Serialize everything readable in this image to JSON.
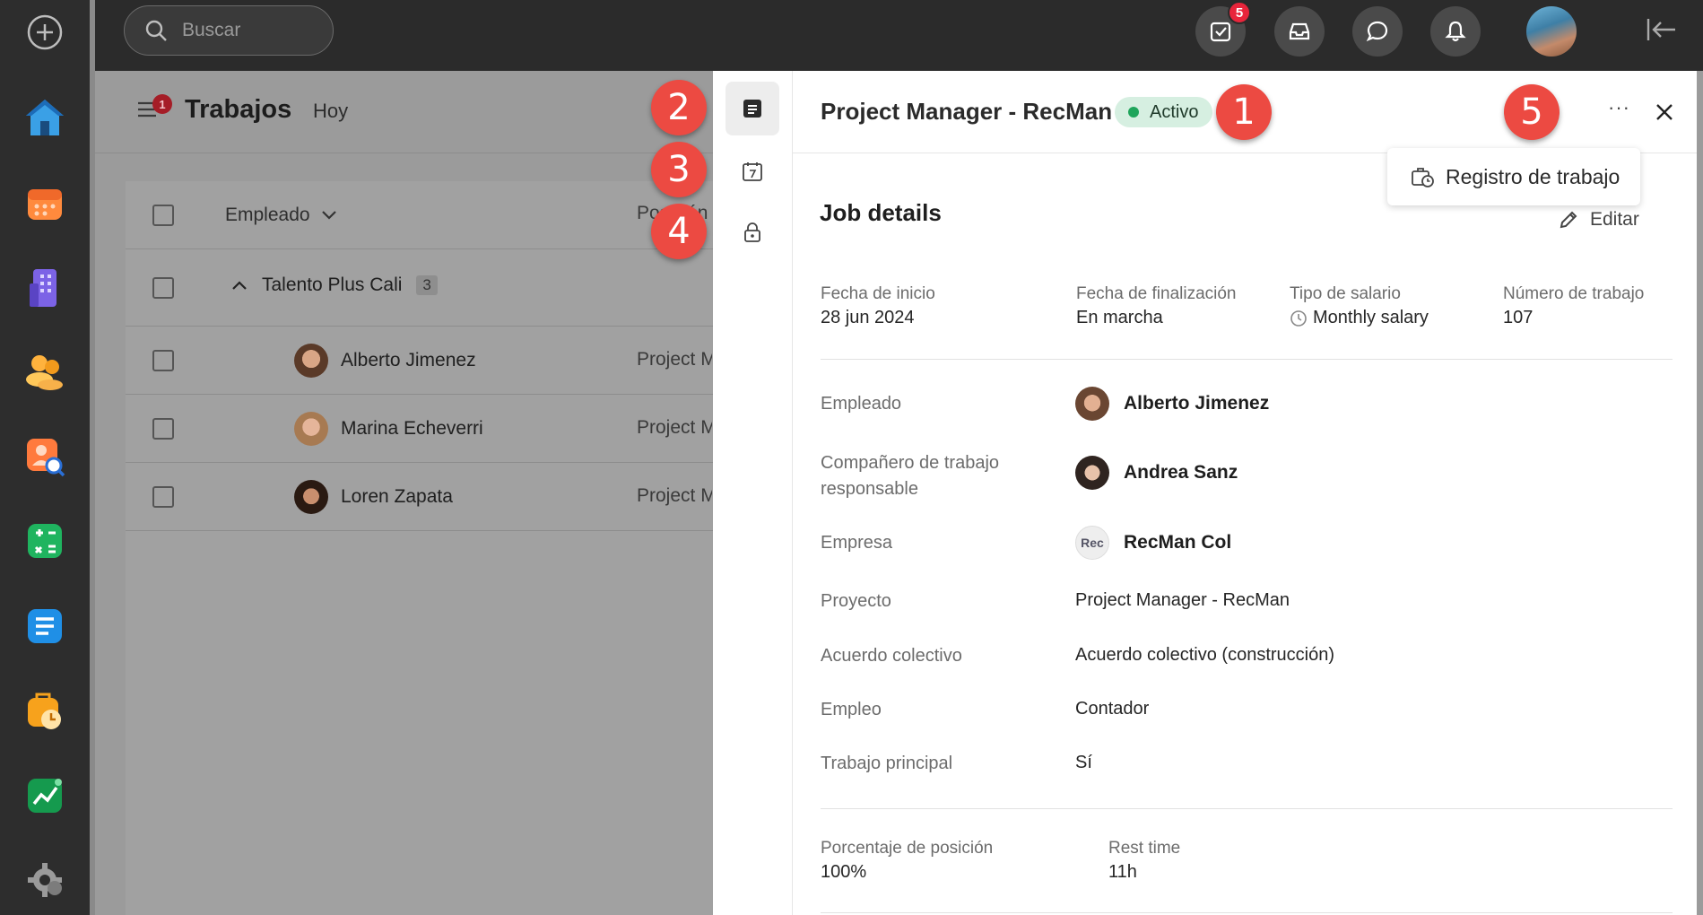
{
  "search": {
    "placeholder": "Buscar"
  },
  "topbar": {
    "tasks_badge": "5"
  },
  "page": {
    "title": "Trabajos",
    "subtitle": "Hoy",
    "menu_badge": "1"
  },
  "table": {
    "header_employee": "Empleado",
    "header_position": "Posición",
    "group": {
      "name": "Talento Plus Cali",
      "count": "3"
    },
    "rows": [
      {
        "name": "Alberto Jimenez",
        "position": "Project Manager - RecMan"
      },
      {
        "name": "Marina Echeverri",
        "position": "Project Manager - RecMan"
      },
      {
        "name": "Loren Zapata",
        "position": "Project Manager - RecMan"
      }
    ]
  },
  "markers": [
    "1",
    "2",
    "3",
    "4",
    "5"
  ],
  "drawer": {
    "title": "Project Manager - RecMan",
    "status": "Activo",
    "menu_item": "Registro de trabajo",
    "section_title": "Job details",
    "edit_label": "Editar",
    "summary": [
      {
        "label": "Fecha de inicio",
        "value": "28 jun 2024"
      },
      {
        "label": "Fecha de finalización",
        "value": "En marcha"
      },
      {
        "label": "Tipo de salario",
        "value": "Monthly salary"
      },
      {
        "label": "Número de trabajo",
        "value": "107"
      }
    ],
    "fields": {
      "employee": {
        "label": "Empleado",
        "value": "Alberto Jimenez"
      },
      "responsible": {
        "label": "Compañero de trabajo responsable",
        "value": "Andrea Sanz"
      },
      "company": {
        "label": "Empresa",
        "value": "RecMan Col",
        "logo_text": "Rec"
      },
      "project": {
        "label": "Proyecto",
        "value": "Project Manager - RecMan"
      },
      "agreement": {
        "label": "Acuerdo colectivo",
        "value": "Acuerdo colectivo (construcción)"
      },
      "job": {
        "label": "Empleo",
        "value": "Contador"
      },
      "main": {
        "label": "Trabajo principal",
        "value": "Sí"
      }
    },
    "footer": [
      {
        "label": "Porcentaje de posición",
        "value": "100%"
      },
      {
        "label": "Rest time",
        "value": "11h"
      }
    ]
  },
  "colors": {
    "status_bg": "#d6efe1",
    "status_dot": "#1fa55b",
    "marker": "#ec4a42",
    "badge": "#e8253b"
  }
}
